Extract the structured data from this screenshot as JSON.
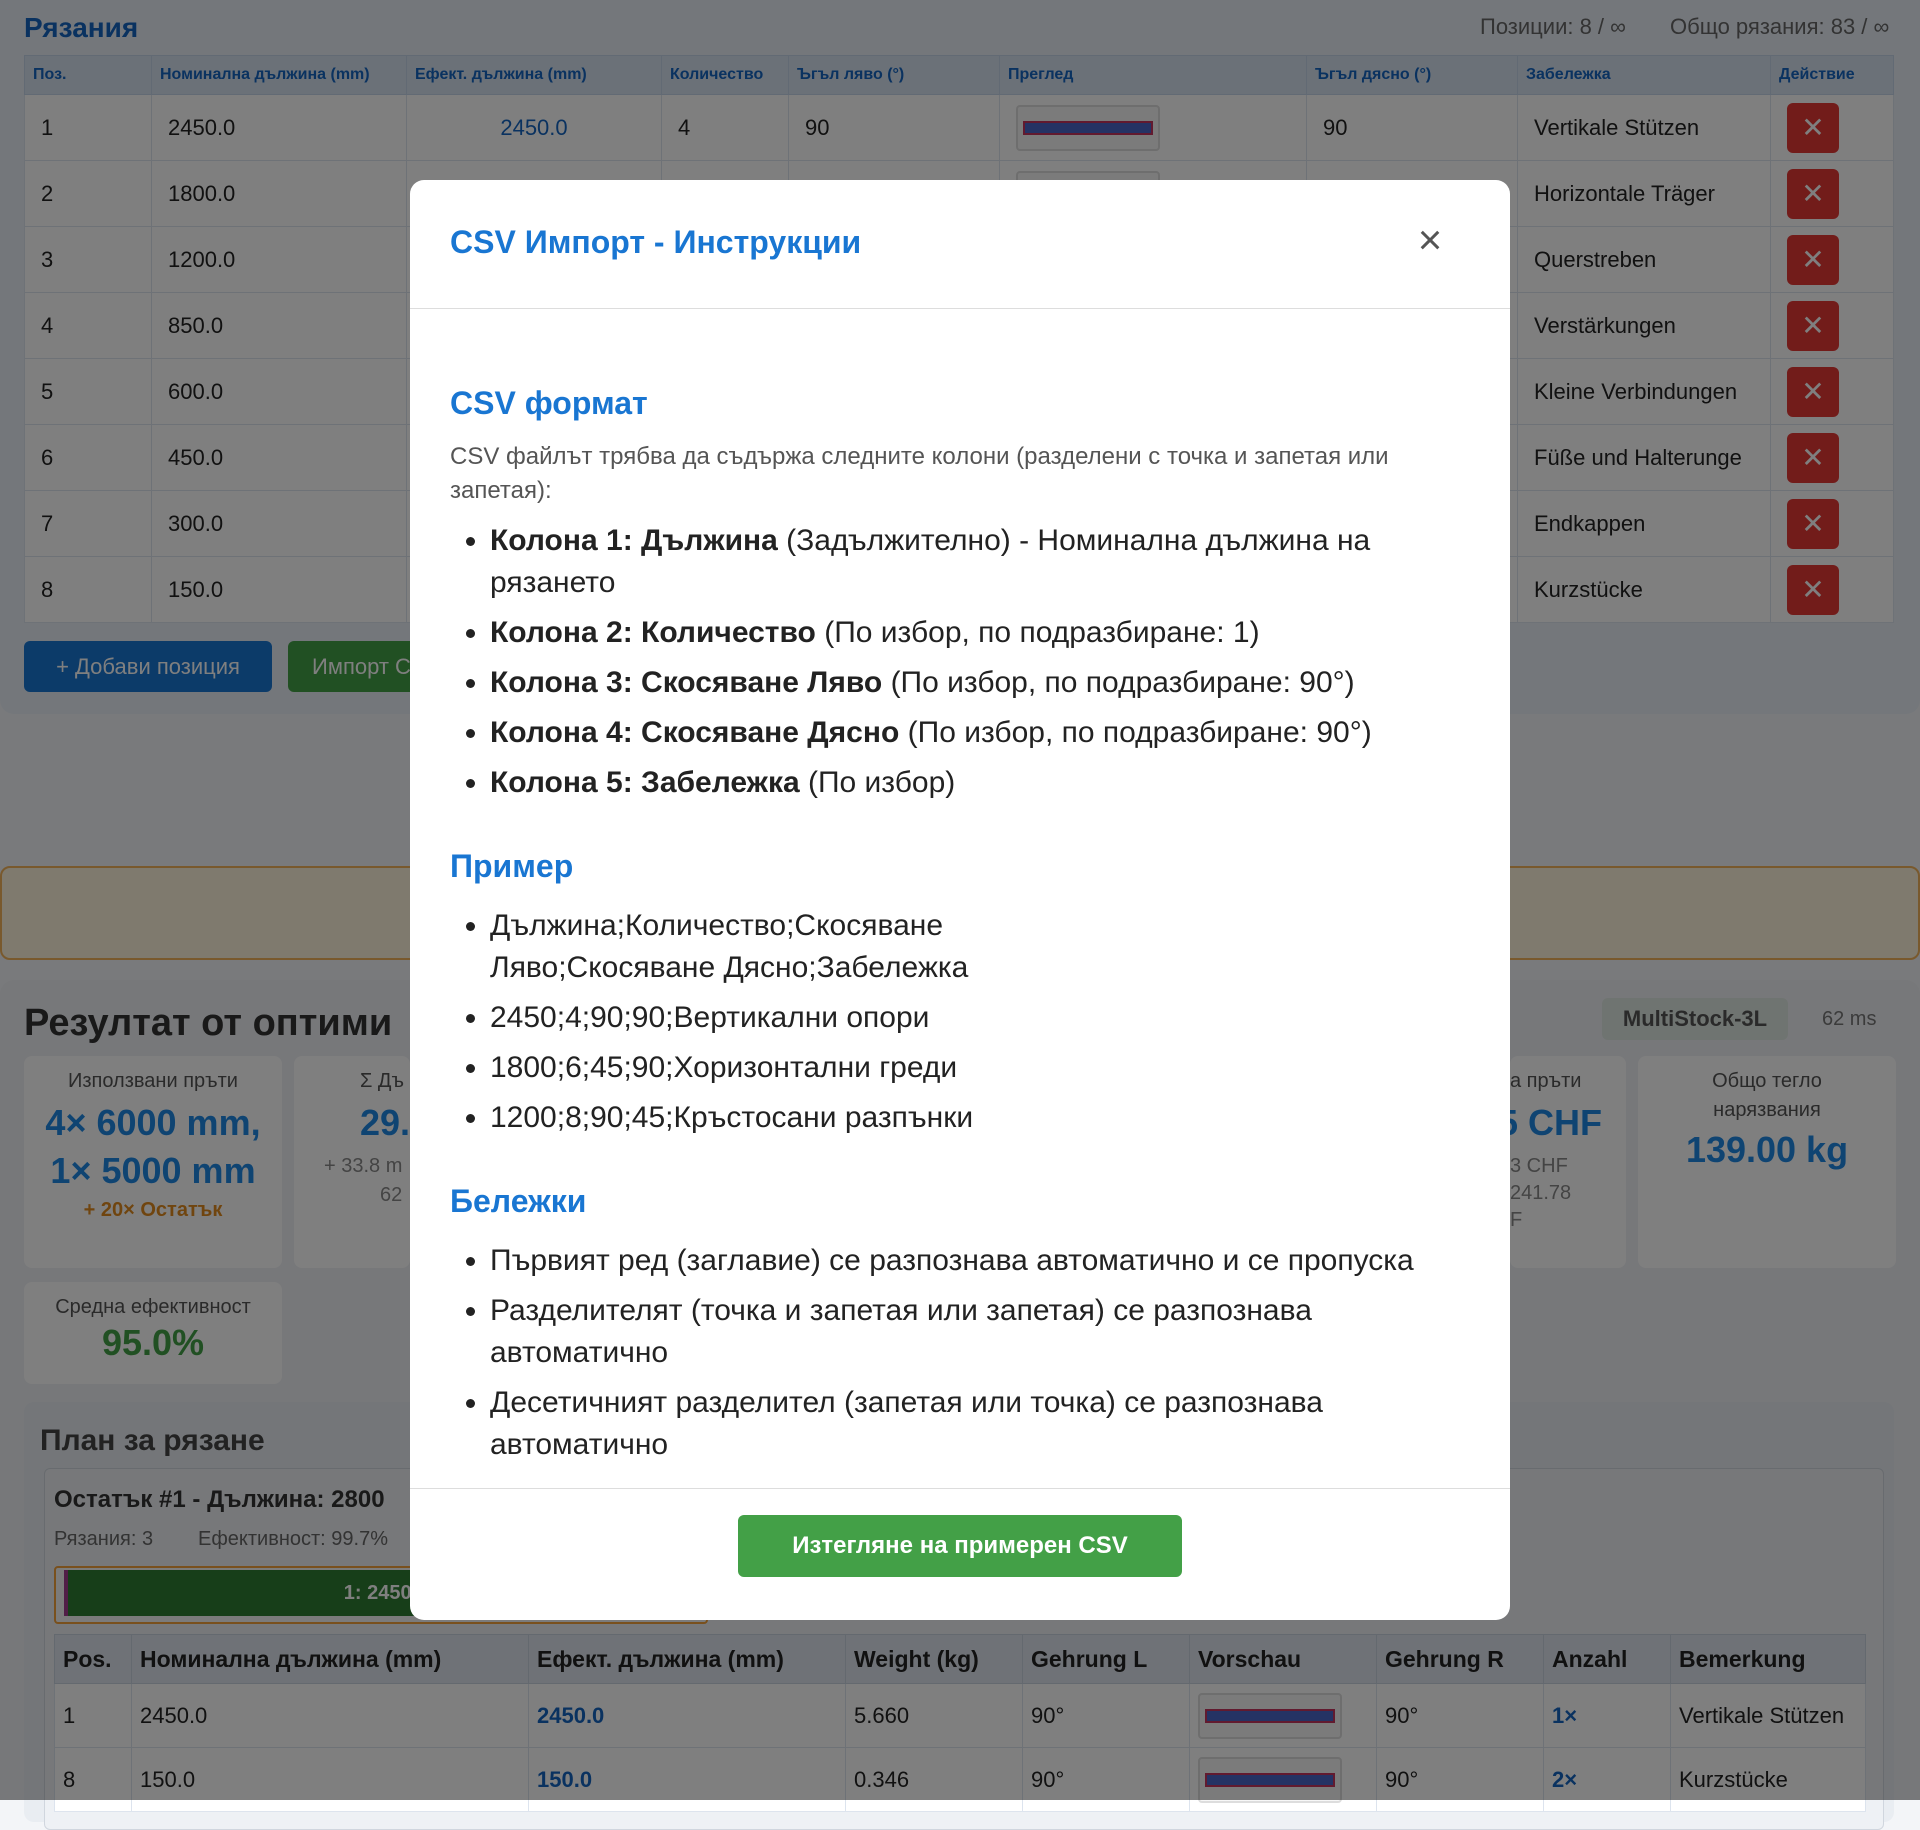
{
  "cuts": {
    "title": "Рязания",
    "positions_info": "Позиции: 8 / ∞",
    "total_info": "Общо рязания: 83 / ∞",
    "headers": [
      "Поз.",
      "Номинална дължина (mm)",
      "Ефект. дължина (mm)",
      "Количество",
      "Ъгъл ляво (°)",
      "Преглед",
      "Ъгъл дясно (°)",
      "Забележка",
      "Действие"
    ],
    "rows": [
      {
        "pos": "1",
        "nominal": "2450.0",
        "effective": "2450.0",
        "qty": "4",
        "angle_l": "90",
        "angle_r": "90",
        "note": "Vertikale Stützen"
      },
      {
        "pos": "2",
        "nominal": "1800.0",
        "effective": "",
        "qty": "",
        "angle_l": "",
        "angle_r": "",
        "note": "Horizontale Träger"
      },
      {
        "pos": "3",
        "nominal": "1200.0",
        "effective": "",
        "qty": "",
        "angle_l": "",
        "angle_r": "",
        "note": "Querstreben"
      },
      {
        "pos": "4",
        "nominal": "850.0",
        "effective": "",
        "qty": "",
        "angle_l": "",
        "angle_r": "",
        "note": "Verstärkungen"
      },
      {
        "pos": "5",
        "nominal": "600.0",
        "effective": "",
        "qty": "",
        "angle_l": "",
        "angle_r": "",
        "note": "Kleine Verbindungen"
      },
      {
        "pos": "6",
        "nominal": "450.0",
        "effective": "",
        "qty": "",
        "angle_l": "",
        "angle_r": "",
        "note": "Füße und Halterunge"
      },
      {
        "pos": "7",
        "nominal": "300.0",
        "effective": "",
        "qty": "",
        "angle_l": "",
        "angle_r": "",
        "note": "Endkappen"
      },
      {
        "pos": "8",
        "nominal": "150.0",
        "effective": "",
        "qty": "",
        "angle_l": "",
        "angle_r": "",
        "note": "Kurzstücke"
      }
    ],
    "add_button": "+ Добави позиция",
    "import_button": "Импорт С"
  },
  "results": {
    "title": "Резултат от оптими",
    "algorithm": "MultiStock-3L",
    "time": "62 ms",
    "card1": {
      "label": "Използвани пръти",
      "value1": "4× 6000 mm,",
      "value2": "1× 5000 mm",
      "sub": "+ 20× Остатък"
    },
    "card2": {
      "label": "Σ Дъ",
      "value": "29.",
      "sub1": "+ 33.8 m",
      "sub2": "62"
    },
    "card3": {
      "label": "а пръти",
      "value": "5 CHF",
      "sub1": "3 CHF",
      "sub2": "241.78",
      "sub3": "F"
    },
    "card4": {
      "label1": "Общо тегло",
      "label2": "нарязвания",
      "value": "139.00 kg"
    },
    "card5": {
      "label": "Средна ефективност",
      "value": "95.0%"
    }
  },
  "plan": {
    "title": "План за рязане",
    "rest_title": "Остатък #1 - Дължина: 2800",
    "rest_cuts": "Рязания: 3",
    "rest_eff": "Ефективност: 99.7%",
    "bar_label": "1: 2450.0",
    "headers": [
      "Pos.",
      "Номинална дължина (mm)",
      "Ефект. дължина (mm)",
      "Weight (kg)",
      "Gehrung L",
      "Vorschau",
      "Gehrung R",
      "Anzahl",
      "Bemerkung"
    ],
    "rows": [
      {
        "pos": "1",
        "nominal": "2450.0",
        "effective": "2450.0",
        "weight": "5.660",
        "gl": "90°",
        "gr": "90°",
        "count": "1×",
        "note": "Vertikale Stützen"
      },
      {
        "pos": "8",
        "nominal": "150.0",
        "effective": "150.0",
        "weight": "0.346",
        "gl": "90°",
        "gr": "90°",
        "count": "2×",
        "note": "Kurzstücke"
      }
    ]
  },
  "modal": {
    "title": "CSV Импорт - Инструкции",
    "close_glyph": "×",
    "format_heading": "CSV формат",
    "format_intro": "CSV файлът трябва да съдържа следните колони (разделени с точка и запетая или запетая):",
    "columns": [
      {
        "bold": "Колона 1: Дължина",
        "rest": " (Задължително) - Номинална дължина на рязането"
      },
      {
        "bold": "Колона 2: Количество",
        "rest": " (По избор, по подразбиране: 1)"
      },
      {
        "bold": "Колона 3: Скосяване Ляво",
        "rest": " (По избор, по подразбиране: 90°)"
      },
      {
        "bold": "Колона 4: Скосяване Дясно",
        "rest": " (По избор, по подразбиране: 90°)"
      },
      {
        "bold": "Колона 5: Забележка",
        "rest": " (По избор)"
      }
    ],
    "example_heading": "Пример",
    "example_lines": [
      "Дължина;Количество;Скосяване Ляво;Скосяване Дясно;Забележка",
      "2450;4;90;90;Вертикални опори",
      "1800;6;45;90;Хоризонтални греди",
      "1200;8;90;45;Кръстосани разпънки"
    ],
    "notes_heading": "Бележки",
    "notes": [
      "Първият ред (заглавие) се разпознава автоматично и се пропуска",
      "Разделителят (точка и запетая или запетая) се разпознава автоматично",
      "Десетичният разделител (запетая или точка) се разпознава автоматично"
    ],
    "download_button": "Изтегляне на примерен CSV"
  },
  "colors": {
    "accent": "#1976d2",
    "danger": "#e53935",
    "success": "#43a047"
  }
}
